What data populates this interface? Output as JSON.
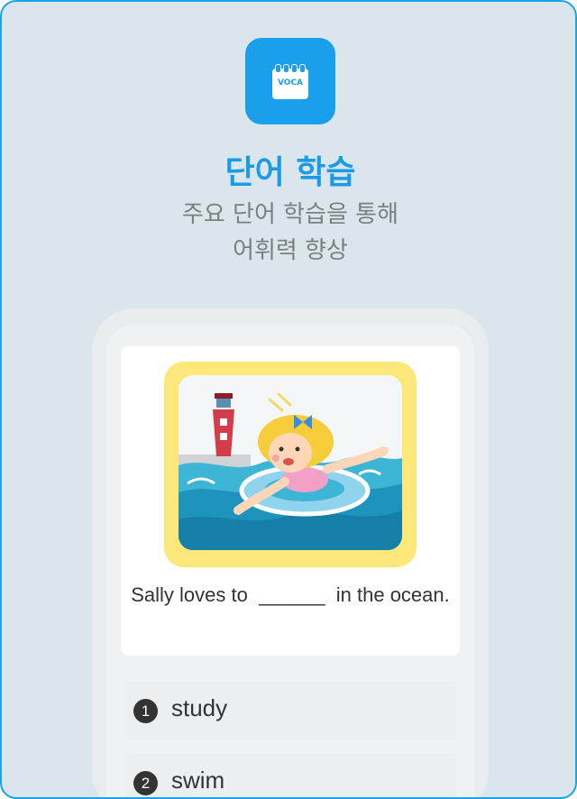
{
  "app_icon": {
    "label": "VOCA"
  },
  "header": {
    "title": "단어 학습",
    "subtitle_line1": "주요 단어 학습을 통해",
    "subtitle_line2": "어휘력 향상"
  },
  "question": {
    "sentence_before": "Sally loves to",
    "blank": "______",
    "sentence_after": "in the ocean.",
    "image": "girl-swimming-illustration"
  },
  "options": [
    {
      "number": "1",
      "label": "study"
    },
    {
      "number": "2",
      "label": "swim"
    }
  ],
  "colors": {
    "accent": "#1aa0ea",
    "background": "#dbe6ec",
    "frame_yellow": "#fce77a"
  }
}
